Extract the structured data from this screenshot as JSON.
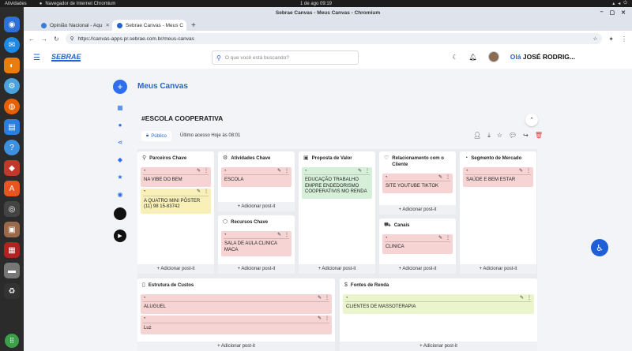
{
  "os": {
    "activities": "Atividades",
    "browser_name": "Navegador de Internet Chromium",
    "clock": "1 de ago  09:19"
  },
  "window": {
    "title": "Sebrae Canvas - Meus Canvas - Chromium"
  },
  "tabs": [
    {
      "label": "Opinião Nacional - Aqu",
      "active": false
    },
    {
      "label": "Sebrae Canvas - Meus C",
      "active": true
    }
  ],
  "url": "https://canvas-apps.pr.sebrae.com.br/meus-canvas",
  "header": {
    "logo": "SEBRAE",
    "search_placeholder": "O que você está buscando?",
    "greeting": "Olá",
    "user": "JOSÉ RODRIG..."
  },
  "page": {
    "title": "Meus Canvas"
  },
  "canvas": {
    "name": "#ESCOLA COOPERATIVA",
    "visibility": "Público",
    "last_access": "Último acesso Hoje às 08:01"
  },
  "add_label": "+ Adicionar post-it",
  "columns": {
    "parceiros": {
      "title": "Parceiros Chave",
      "notes": [
        {
          "text": "NA VIBE DO BEM",
          "color": "#f7d4d4"
        },
        {
          "text": "A QUATRO MINI PÔSTER (11) 98 15-83742",
          "color": "#f8f0b8"
        }
      ]
    },
    "atividades": {
      "title": "Atividades Chave",
      "notes": [
        {
          "text": "ESCOLA",
          "color": "#f7d4d4"
        }
      ]
    },
    "recursos": {
      "title": "Recursos Chave",
      "notes": [
        {
          "text": "SALA DE AULA CLINICA MACA",
          "color": "#f7d4d4"
        }
      ]
    },
    "proposta": {
      "title": "Proposta de Valor",
      "notes": [
        {
          "text": "EDUCAÇÃO TRABALHO EMPRE ENDEDORISMO COOPERATIVIS MO RENDA",
          "color": "#d6efd9"
        }
      ]
    },
    "relacionamento": {
      "title": "Relacionamento com o Cliente",
      "notes": [
        {
          "text": "SITE YOUTUBE TIKTOK",
          "color": "#f7d4d4"
        }
      ]
    },
    "canais": {
      "title": "Canais",
      "notes": [
        {
          "text": "CLINICA",
          "color": "#f7d4d4"
        }
      ]
    },
    "segmento": {
      "title": "Segmento de Mercado",
      "notes": [
        {
          "text": "SAÚDE E BEM ESTAR",
          "color": "#f7d4d4"
        }
      ]
    },
    "custos": {
      "title": "Estrutura de Custos",
      "notes": [
        {
          "text": "ALUGUEL",
          "color": "#f7d4d4"
        },
        {
          "text": "Luz",
          "color": "#f7d4d4"
        }
      ]
    },
    "receita": {
      "title": "Fontes de Renda",
      "notes": [
        {
          "text": "CLIENTES DE MASSOTERAPIA",
          "color": "#eaf5cc"
        }
      ]
    }
  }
}
